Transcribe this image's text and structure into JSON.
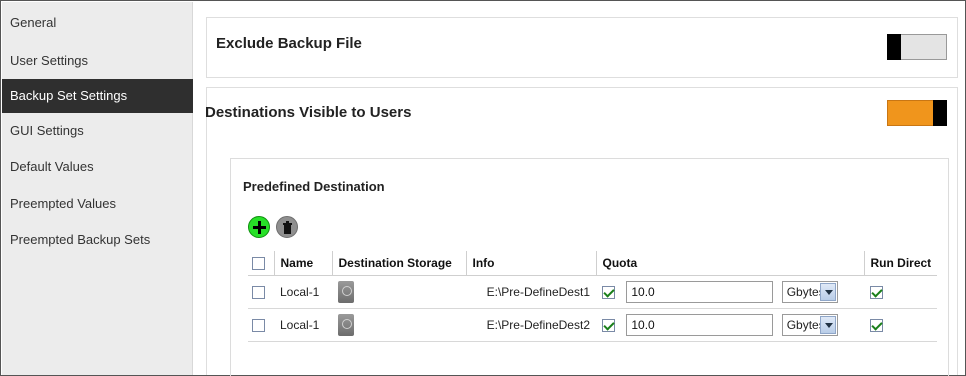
{
  "sidebar": {
    "items": [
      {
        "label": "General"
      },
      {
        "label": "User Settings"
      },
      {
        "label": "Backup Set Settings"
      },
      {
        "label": "GUI Settings"
      },
      {
        "label": "Default Values"
      },
      {
        "label": "Preempted Values"
      },
      {
        "label": "Preempted Backup Sets"
      }
    ],
    "active_index": 2
  },
  "exclude_backup": {
    "title": "Exclude Backup File",
    "toggle_on": false
  },
  "destinations": {
    "title": "Destinations Visible to Users",
    "toggle_on": true,
    "toggle_color": "#f0951c",
    "predefined": {
      "title": "Predefined Destination",
      "add_icon": "plus-circle-icon",
      "delete_icon": "trash-icon",
      "columns": [
        "Name",
        "Destination Storage",
        "Info",
        "Quota",
        "Run Direct"
      ],
      "rows": [
        {
          "name": "Local-1",
          "storage_icon": "hard-drive-icon",
          "info": "E:\\Pre-DefineDest1",
          "quota_enabled": true,
          "quota_value": "10.0",
          "unit": "Gbytes",
          "run_direct": true
        },
        {
          "name": "Local-1",
          "storage_icon": "hard-drive-icon",
          "info": "E:\\Pre-DefineDest2",
          "quota_enabled": true,
          "quota_value": "10.0",
          "unit": "Gbytes",
          "run_direct": true
        }
      ]
    }
  }
}
